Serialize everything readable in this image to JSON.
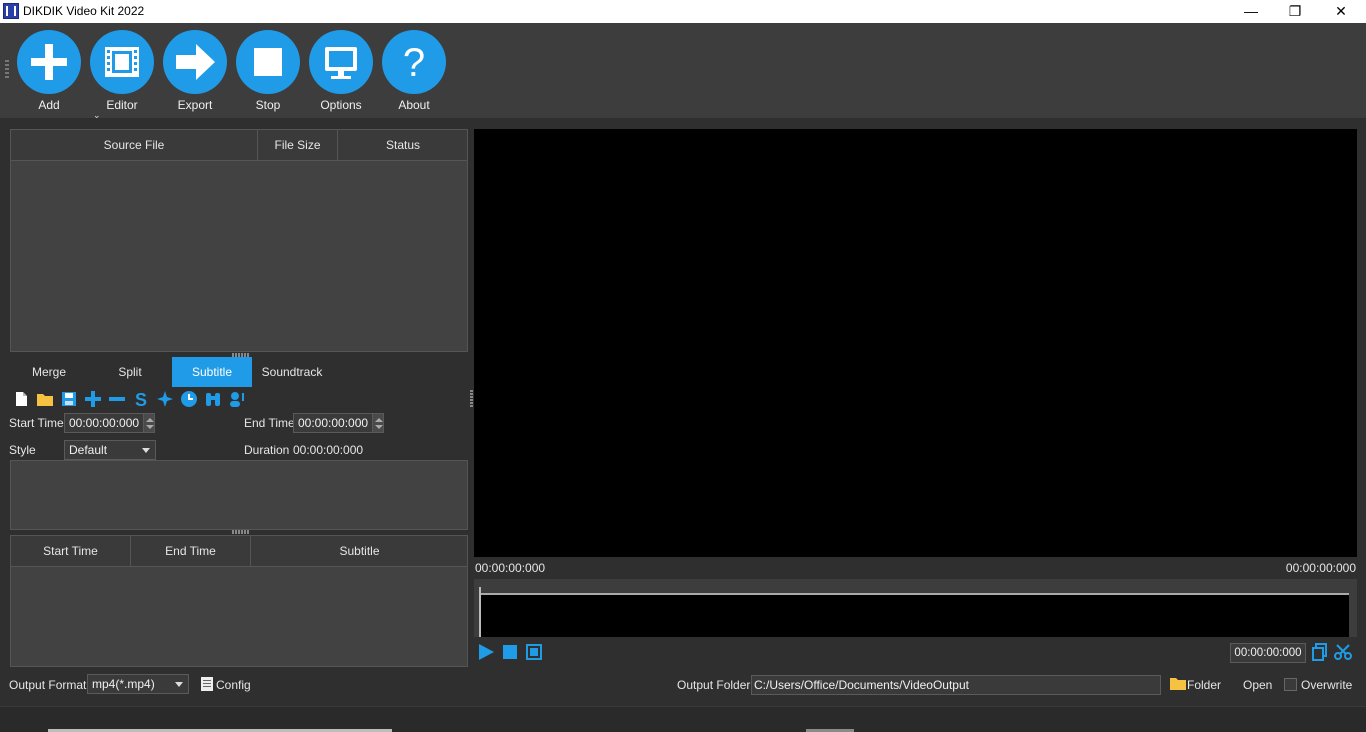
{
  "window": {
    "title": "DIKDIK Video Kit 2022",
    "minimize": "—",
    "restore": "❐",
    "close": "✕"
  },
  "toolbar": {
    "items": [
      {
        "label": "Add",
        "icon": "plus-icon"
      },
      {
        "label": "Editor",
        "icon": "film-icon"
      },
      {
        "label": "Export",
        "icon": "arrow-right-icon"
      },
      {
        "label": "Stop",
        "icon": "stop-icon"
      },
      {
        "label": "Options",
        "icon": "monitor-icon"
      },
      {
        "label": "About",
        "icon": "question-icon"
      }
    ],
    "add_dropdown": "⌄"
  },
  "source_table": {
    "columns": [
      "Source File",
      "File Size",
      "Status"
    ],
    "rows": []
  },
  "tabs": [
    {
      "label": "Merge",
      "active": false
    },
    {
      "label": "Split",
      "active": false
    },
    {
      "label": "Subtitle",
      "active": true
    },
    {
      "label": "Soundtrack",
      "active": false
    }
  ],
  "subtitle_tools": [
    "new-file-icon",
    "open-folder-icon",
    "save-icon",
    "add-icon",
    "remove-icon",
    "dollar-s-icon",
    "sparkle-icon",
    "clock-icon",
    "binoculars-icon",
    "speaker-person-icon"
  ],
  "subtitle_form": {
    "start_time_label": "Start Time",
    "start_time_value": "00:00:00:000",
    "end_time_label": "End Time",
    "end_time_value": "00:00:00:000",
    "style_label": "Style",
    "style_value": "Default",
    "duration_label": "Duration",
    "duration_value": "00:00:00:000"
  },
  "subtitle_table": {
    "columns": [
      "Start Time",
      "End Time",
      "Subtitle"
    ],
    "rows": []
  },
  "output": {
    "format_label": "Output Format",
    "format_value": "mp4(*.mp4)",
    "config_label": "Config",
    "folder_label": "Output Folder",
    "folder_value": "C:/Users/Office/Documents/VideoOutput",
    "folder_button": "Folder",
    "open_button": "Open",
    "overwrite_label": "Overwrite"
  },
  "player": {
    "time_start": "00:00:00:000",
    "time_end": "00:00:00:000",
    "seek_time": "00:00:00:000"
  },
  "colors": {
    "accent": "#1f9be7",
    "background": "#2f2f2f",
    "panel": "#424242"
  }
}
